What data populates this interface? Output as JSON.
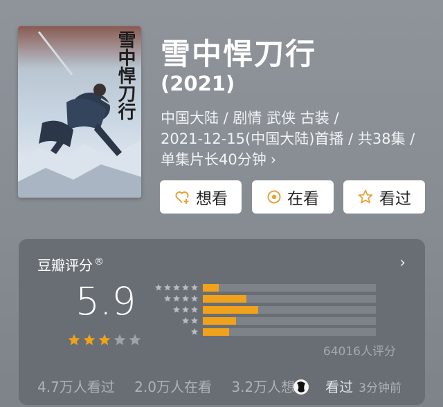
{
  "movie": {
    "title": "雪中悍刀行",
    "year": "(2021)",
    "meta_line1": "中国大陆 / 剧情 武侠 古装 /",
    "meta_line2": "2021-12-15(中国大陆)首播 / 共38集 /",
    "meta_line3": "单集片长40分钟",
    "poster_text": "雪中悍刀行"
  },
  "actions": {
    "want": "想看",
    "watching": "在看",
    "watched": "看过"
  },
  "rating": {
    "label": "豆瓣评分",
    "reg": "®",
    "score": "5.9",
    "stars": 3,
    "distribution": [
      {
        "stars": 5,
        "fraction": 0.09
      },
      {
        "stars": 4,
        "fraction": 0.25
      },
      {
        "stars": 3,
        "fraction": 0.32
      },
      {
        "stars": 2,
        "fraction": 0.19
      },
      {
        "stars": 1,
        "fraction": 0.15
      }
    ],
    "count": "64016人评分"
  },
  "stats": {
    "watched": "4.7万人看过",
    "watching": "2.0万人在看",
    "want": "3.2万人想",
    "overlay": "看过",
    "time": "3分钟前"
  },
  "colors": {
    "accent": "#f0a21c",
    "button_icon": "#e8a23a"
  }
}
